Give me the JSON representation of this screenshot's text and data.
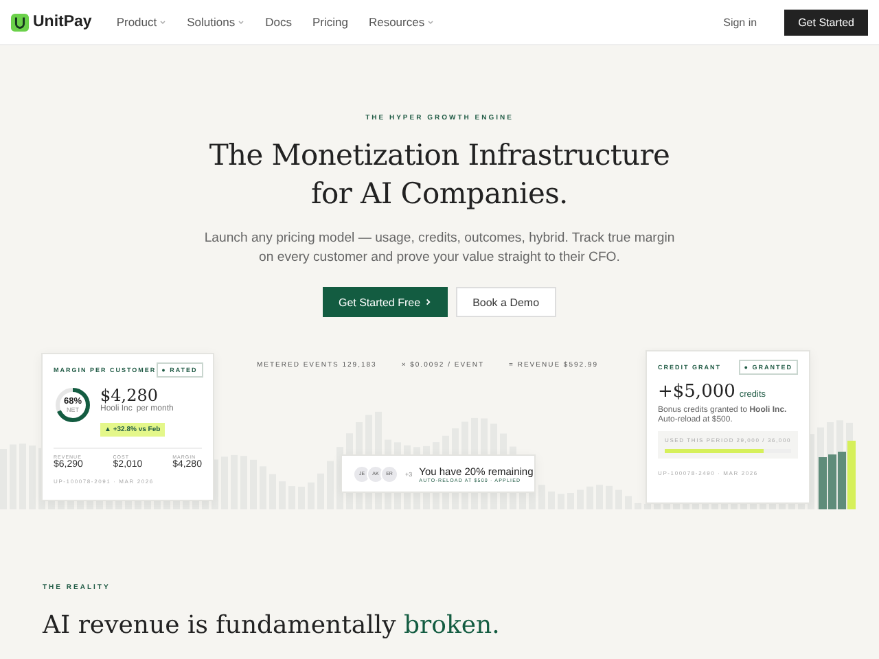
{
  "nav": {
    "brand": "UnitPay",
    "links": [
      {
        "label": "Product",
        "dropdown": true
      },
      {
        "label": "Solutions",
        "dropdown": true
      },
      {
        "label": "Docs",
        "dropdown": false
      },
      {
        "label": "Pricing",
        "dropdown": false
      },
      {
        "label": "Resources",
        "dropdown": true
      }
    ],
    "sign_in": "Sign in",
    "cta": "Get Started"
  },
  "hero": {
    "eyebrow": "THE HYPER GROWTH ENGINE",
    "title_lines": [
      "The Monetization Infrastructure",
      "for AI Companies."
    ],
    "subtitle_lines": [
      "Launch any pricing model — usage, credits, outcomes, hybrid. Track true margin",
      "on every customer and prove your value straight to their CFO."
    ],
    "primary": "Get Started Free",
    "secondary": "Book a Demo"
  },
  "margin_card": {
    "title": "MARGIN PER CUSTOMER",
    "badge": "● RATED",
    "ring_value": "68%",
    "ring_caption": "NET",
    "amount": "$4,280",
    "customer": "Hooli Inc",
    "period": "per month",
    "change": "▲ +32.8% vs Feb",
    "stats": [
      {
        "label": "REVENUE",
        "value": "$6,290"
      },
      {
        "label": "COST",
        "value": "$2,010"
      },
      {
        "label": "MARGIN",
        "value": "$4,280"
      }
    ],
    "footer": "UP-100078-2091 · MAR 2026"
  },
  "meter_strip": [
    "METERED EVENTS 129,183",
    "× $0.0092 / EVENT",
    "= REVENUE $592.99"
  ],
  "alert": {
    "avatars": [
      "JE",
      "AK",
      "ER"
    ],
    "more": "+3",
    "message": "You have 20% remaining",
    "detail": "AUTO-RELOAD AT $500 · APPLIED"
  },
  "credit_card": {
    "title": "CREDIT GRANT",
    "badge": "● GRANTED",
    "amount": "+$5,000",
    "unit": "credits",
    "line1": "Bonus credits granted to **Hooli Inc.**",
    "line2": "Auto-reload at $500.",
    "usage_label": "USED THIS PERIOD",
    "usage_value": "29,000 / 36,000",
    "level": 0.78,
    "footer": "UP-100078-2490 · MAR 2026"
  },
  "reality": {
    "eyebrow": "THE REALITY",
    "heading": "AI revenue is fundamentally",
    "accent": "broken."
  }
}
